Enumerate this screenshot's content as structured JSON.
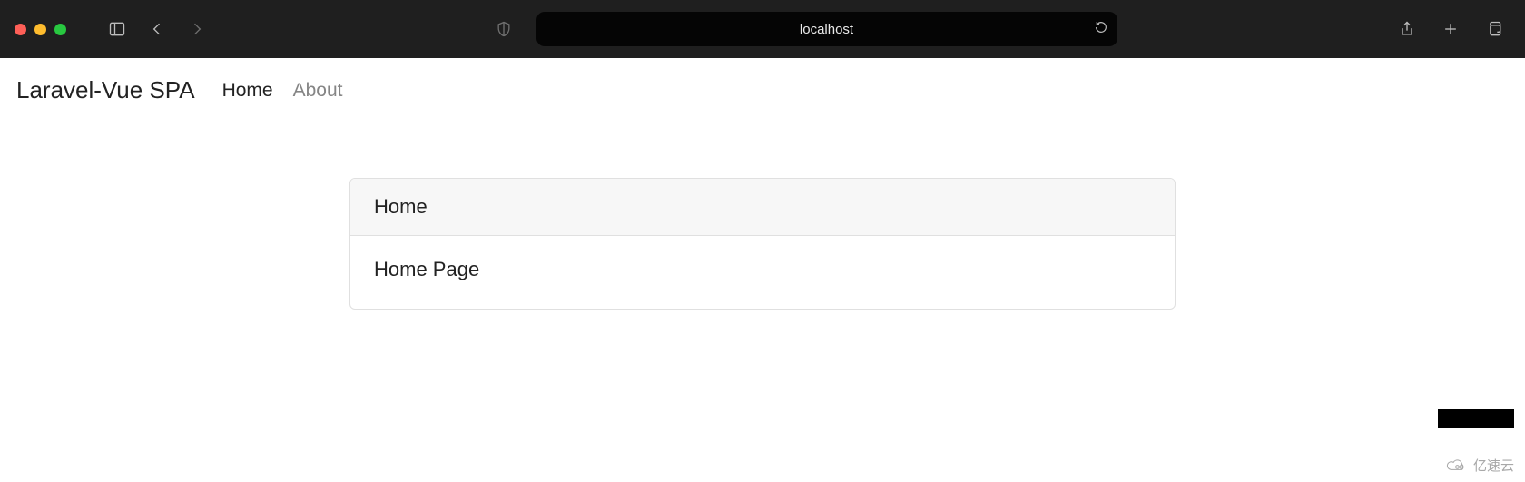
{
  "browser": {
    "url_display": "localhost"
  },
  "navbar": {
    "brand": "Laravel-Vue SPA",
    "links": {
      "home": "Home",
      "about": "About"
    }
  },
  "card": {
    "title": "Home",
    "body": "Home Page"
  },
  "watermark": {
    "text": "亿速云"
  }
}
